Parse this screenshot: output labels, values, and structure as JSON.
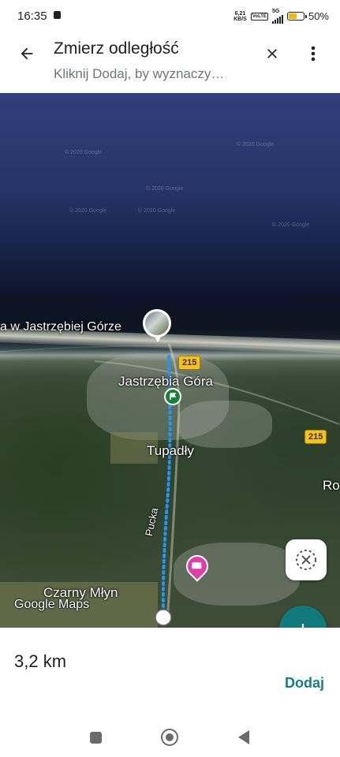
{
  "status_bar": {
    "time": "16:35",
    "speed_value": "6,21",
    "speed_unit": "KB/S",
    "volte_tag": "VoLTE",
    "network": "5G",
    "battery_percent": "50%",
    "battery_level": 0.5
  },
  "header": {
    "title": "Zmierz odległość",
    "subtitle": "Kliknij Dodaj, by wyznaczy…"
  },
  "map": {
    "labels": {
      "beach": "a w Jastrzębiej Górze",
      "town": "Jastrzębia Góra",
      "village": "Tupadły",
      "edge": "Ro",
      "south_village": "Czarny Młyn",
      "street": "Pucka"
    },
    "road_badges": [
      "215",
      "215"
    ],
    "logo": "Google Maps",
    "watermark": "© 2020 Google"
  },
  "sheet": {
    "distance": "3,2 km",
    "add_label": "Dodaj"
  },
  "colors": {
    "accent": "#137e85",
    "fab": "#117a7a",
    "measure_line": "#2196f3"
  }
}
